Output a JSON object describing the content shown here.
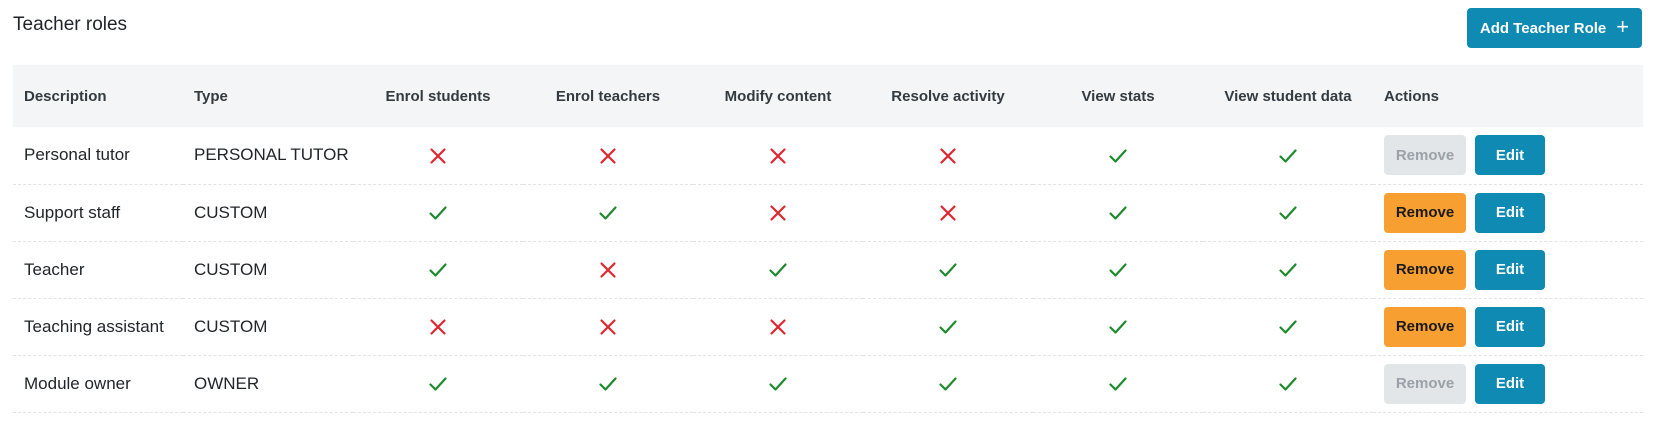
{
  "page": {
    "title": "Teacher roles",
    "add_button_label": "Add Teacher Role"
  },
  "colors": {
    "accent": "#0e8ab3",
    "remove": "#f7a031",
    "check": "#1e8a2e",
    "cross": "#e0262e"
  },
  "table": {
    "headers": [
      "Description",
      "Type",
      "Enrol students",
      "Enrol teachers",
      "Modify content",
      "Resolve activity",
      "View stats",
      "View student data",
      "Actions"
    ],
    "rows": [
      {
        "description": "Personal tutor",
        "type": "PERSONAL TUTOR",
        "perms": [
          false,
          false,
          false,
          false,
          true,
          true
        ],
        "remove_label": "Remove",
        "remove_enabled": false,
        "edit_label": "Edit"
      },
      {
        "description": "Support staff",
        "type": "CUSTOM",
        "perms": [
          true,
          true,
          false,
          false,
          true,
          true
        ],
        "remove_label": "Remove",
        "remove_enabled": true,
        "edit_label": "Edit"
      },
      {
        "description": "Teacher",
        "type": "CUSTOM",
        "perms": [
          true,
          false,
          true,
          true,
          true,
          true
        ],
        "remove_label": "Remove",
        "remove_enabled": true,
        "edit_label": "Edit"
      },
      {
        "description": "Teaching assistant",
        "type": "CUSTOM",
        "perms": [
          false,
          false,
          false,
          true,
          true,
          true
        ],
        "remove_label": "Remove",
        "remove_enabled": true,
        "edit_label": "Edit"
      },
      {
        "description": "Module owner",
        "type": "OWNER",
        "perms": [
          true,
          true,
          true,
          true,
          true,
          true
        ],
        "remove_label": "Remove",
        "remove_enabled": false,
        "edit_label": "Edit"
      }
    ]
  }
}
